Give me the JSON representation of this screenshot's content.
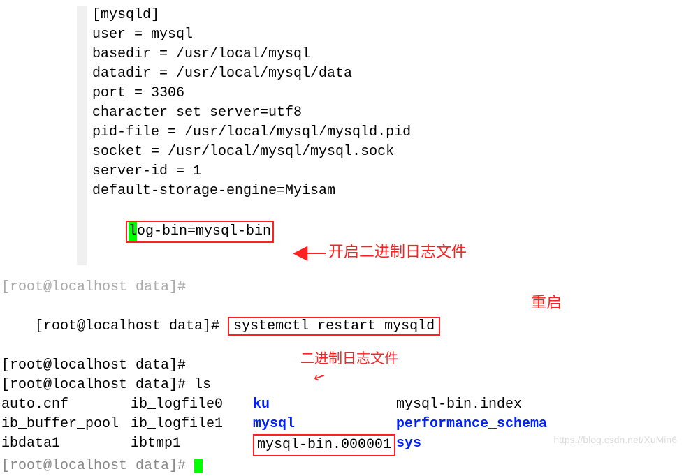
{
  "config": {
    "lines": [
      "[mysqld]",
      "user = mysql",
      "basedir = /usr/local/mysql",
      "datadir = /usr/local/mysql/data",
      "port = 3306",
      "character_set_server=utf8",
      "pid-file = /usr/local/mysql/mysqld.pid",
      "socket = /usr/local/mysql/mysql.sock",
      "server-id = 1",
      "default-storage-engine=Myisam"
    ],
    "highlighted_char": "l",
    "highlighted_rest": "og-bin=mysql-bin",
    "annotation1": "开启二进制日志文件"
  },
  "terminal": {
    "prompt_prefix": "[root@localhost data]# ",
    "cmd1": "systemctl restart mysqld",
    "annotation2": "重启",
    "cmd2": "ls",
    "annotation3": "二进制日志文件",
    "ls": {
      "r0": {
        "c0": "auto.cnf",
        "c1": "ib_logfile0",
        "c2": "ku",
        "c3": "mysql-bin.index"
      },
      "r1": {
        "c0": "ib_buffer_pool",
        "c1": "ib_logfile1",
        "c2": "mysql",
        "c3": "performance_schema"
      },
      "r2": {
        "c0": "ibdata1",
        "c1": "ibtmp1",
        "c2": "mysql-bin.000001",
        "c3": "sys"
      }
    }
  },
  "watermark": "https://blog.csdn.net/XuMin6"
}
